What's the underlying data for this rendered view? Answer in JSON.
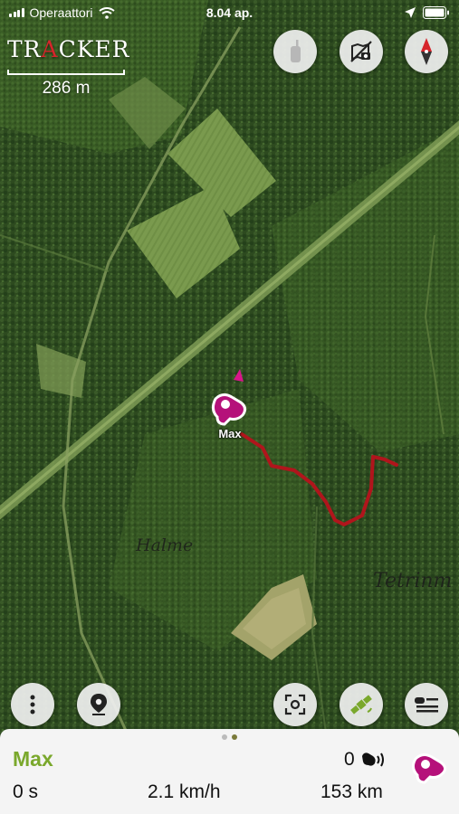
{
  "status_bar": {
    "carrier": "Operaattori",
    "time": "8.04 ap."
  },
  "map": {
    "brand_prefix": "TR",
    "brand_accent": "A",
    "brand_suffix": "CKER",
    "scale_label": "286 m",
    "place_labels": [
      "Halme",
      "Tetrinm"
    ],
    "dog_label": "Max"
  },
  "buttons": {
    "top": [
      {
        "name": "handheld-device-icon"
      },
      {
        "name": "map-layers-icon"
      },
      {
        "name": "compass-icon"
      }
    ],
    "bottom": [
      {
        "name": "more-icon"
      },
      {
        "name": "location-pin-icon"
      },
      {
        "name": "center-focus-icon"
      },
      {
        "name": "satellite-icon"
      },
      {
        "name": "dog-list-icon"
      }
    ]
  },
  "panel": {
    "dog_name": "Max",
    "bark_count": "0",
    "time_since": "0 s",
    "speed": "2.1 km/h",
    "distance": "153 km",
    "page_dots": 2,
    "active_dot": 1
  },
  "colors": {
    "accent_green": "#7aa82c",
    "track_red": "#b0151c",
    "dog_marker": "#b5117a",
    "brand_red": "#d6252b"
  }
}
